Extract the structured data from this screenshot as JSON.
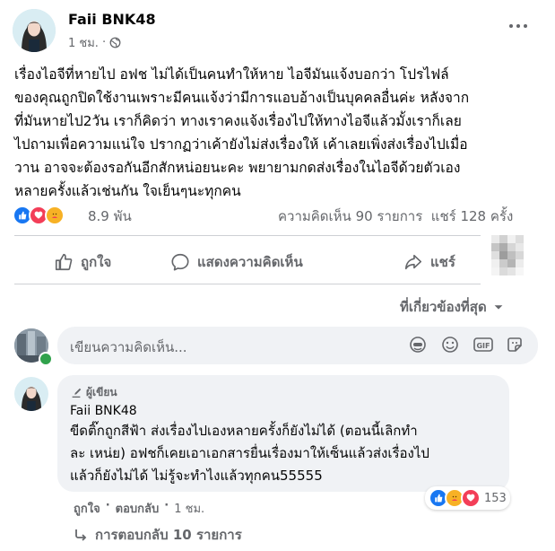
{
  "post": {
    "author": "Faii BNK48",
    "time": "1 ชม.",
    "globe_icon": "globe-icon",
    "menu_icon": "more-horizontal-icon",
    "body": "เรื่องไอจีที่หายไป อฟช ไม่ได้เป็นคนทำให้หาย ไอจีมันแจ้งบอกว่า โปรไฟล์\nของคุณถูกปิดใช้งานเพราะมีคนแจ้งว่ามีการแอบอ้างเป็นบุคคลอื่นค่ะ หลังจาก\nที่มันหายไป2วัน เราก็คิดว่า ทางเราคงแจ้งเรื่องไปให้ทางไอจีแล้วมั้งเราก็เลย\nไปถามเพื่อความแน่ใจ ปรากฏว่าเค้ายังไม่ส่งเรื่องให้ เค้าเลยเพิ่งส่งเรื่องไปเมื่อ\nวาน อาจจะต้องรอกันอีกสักหน่อยนะคะ พยายามกดส่งเรื่องในไอจีด้วยตัวเอง\nหลายครั้งแล้วเช่นกัน ใจเย็นๆนะทุกคน"
  },
  "stats": {
    "reactions_count": "8.9 พัน",
    "comments_shares": "ความคิดเห็น 90 รายการ  แชร์ 128 ครั้ง"
  },
  "actions": {
    "like": "ถูกใจ",
    "comment": "แสดงความคิดเห็น",
    "share": "แชร์"
  },
  "sort_label": "ที่เกี่ยวข้องที่สุด",
  "composer": {
    "placeholder": "เขียนความคิดเห็น..."
  },
  "comment": {
    "badge": "ผู้เขียน",
    "author": "Faii BNK48",
    "text": "ขีดติ๊กถูกสีฟ้า ส่งเรื่องไปเองหลายครั้งก็ยังไม่ได้ (ตอนนี้เลิกทำ\nละ เหน่ย) อฟชก็เคยเอาเอกสารยื่นเรื่องมาให้เซ็นแล้วส่งเรื่องไป\nแล้วก็ยังไม่ได้ ไม่รู้จะทำไงแล้วทุกคน55555",
    "reactions_count": "153",
    "like": "ถูกใจ",
    "reply": "ตอบกลับ",
    "time": "1 ชม.",
    "replies": "การตอบกลับ 10 รายการ"
  },
  "colors": {
    "like_blue": "#1877f2",
    "love_red": "#f33e58",
    "care_yellow": "#f7b125",
    "online_green": "#31a24c"
  }
}
